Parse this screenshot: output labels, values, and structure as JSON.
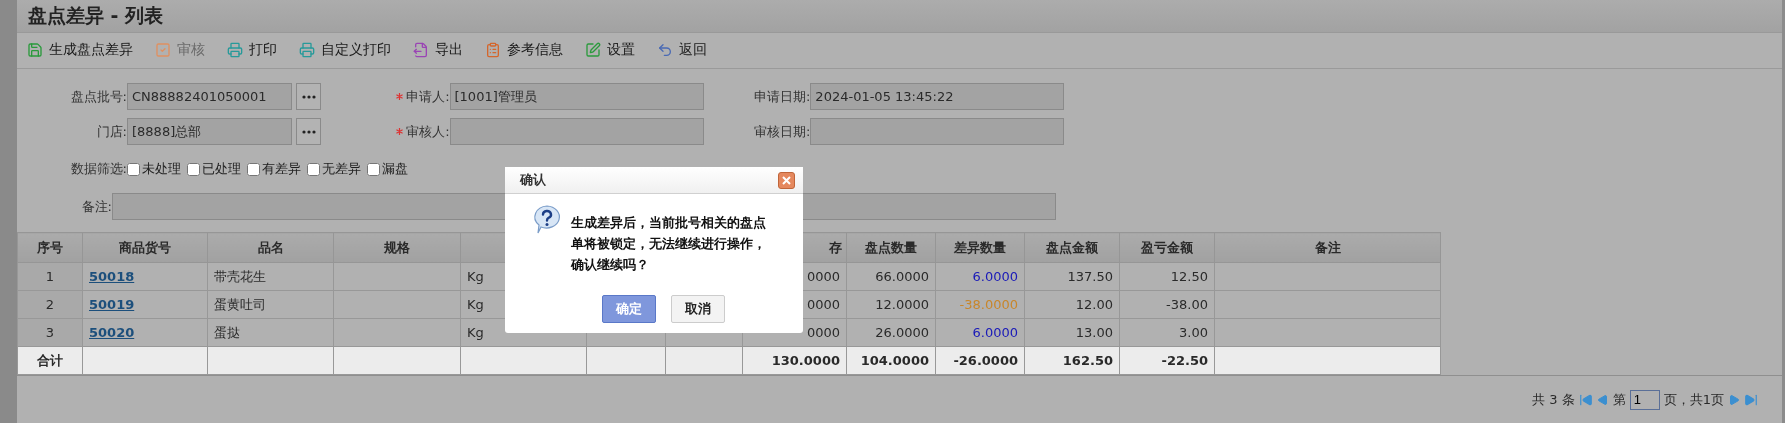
{
  "page": {
    "title": "盘点差异 - 列表"
  },
  "toolbar": [
    {
      "kind": "save",
      "label": "生成盘点差异",
      "disabled": false
    },
    {
      "kind": "check",
      "label": "审核",
      "disabled": true
    },
    {
      "kind": "print",
      "label": "打印",
      "disabled": false
    },
    {
      "kind": "print",
      "label": "自定义打印",
      "disabled": false
    },
    {
      "kind": "export",
      "label": "导出",
      "disabled": false
    },
    {
      "kind": "info",
      "label": "参考信息",
      "disabled": false
    },
    {
      "kind": "edit",
      "label": "设置",
      "disabled": false
    },
    {
      "kind": "back",
      "label": "返回",
      "disabled": false
    }
  ],
  "form": {
    "rows": [
      [
        {
          "label": "盘点批号:",
          "value": "CN88882401050001",
          "picker": true,
          "required": false
        },
        {
          "label": "申请人:",
          "value": "[1001]管理员",
          "picker": false,
          "required": true
        },
        {
          "label": "申请日期:",
          "value": "2024-01-05 13:45:22",
          "picker": false,
          "required": false
        }
      ],
      [
        {
          "label": "门店:",
          "value": "[8888]总部",
          "picker": true,
          "required": false
        },
        {
          "label": "审核人:",
          "picker": false,
          "required": true
        },
        {
          "label": "审核日期:",
          "picker": false,
          "required": false
        }
      ]
    ],
    "filter": {
      "label": "数据筛选:",
      "options": [
        {
          "label": "未处理",
          "checked": false
        },
        {
          "label": "已处理",
          "checked": false
        },
        {
          "label": "有差异",
          "checked": false
        },
        {
          "label": "无差异",
          "checked": false
        },
        {
          "label": "漏盘",
          "checked": false
        }
      ]
    },
    "note": {
      "label": "备注:"
    }
  },
  "table": {
    "columns": [
      {
        "label": "序号"
      },
      {
        "label": "商品货号"
      },
      {
        "label": "品名"
      },
      {
        "label": "规格"
      },
      {},
      {},
      {},
      {
        "label": "存"
      },
      {
        "label": "盘点数量"
      },
      {
        "label": "差异数量"
      },
      {
        "label": "盘点金额"
      },
      {
        "label": "盈亏金额"
      },
      {
        "label": "备注"
      }
    ],
    "rows": [
      {
        "no": "1",
        "code": "50018",
        "name": "带壳花生",
        "unit": "Kg",
        "column_8": "0000",
        "count": "66.0000",
        "diff": {
          "text": "6.0000",
          "color": "#1a1ab8"
        },
        "amount": "137.50",
        "profit": "12.50"
      },
      {
        "no": "2",
        "code": "50019",
        "name": "蛋黄吐司",
        "unit": "Kg",
        "column_8": "0000",
        "count": "12.0000",
        "diff": {
          "text": "-38.0000",
          "color": "#c8862a"
        },
        "amount": "12.00",
        "profit": "-38.00"
      },
      {
        "no": "3",
        "code": "50020",
        "name": "蛋挞",
        "unit": "Kg",
        "column_8": "0000",
        "count": "26.0000",
        "diff": {
          "text": "6.0000",
          "color": "#1a1ab8"
        },
        "amount": "13.00",
        "profit": "3.00"
      }
    ],
    "total": {
      "label": "合计",
      "column_8": "130.0000",
      "count": "104.0000",
      "diff": "-26.0000",
      "amount": "162.50",
      "profit": "-22.50"
    }
  },
  "pagination": {
    "total": "共 3 条",
    "page_prefix": "第",
    "page": "1",
    "page_suffix": "页，共1页"
  },
  "dialog": {
    "title": "确认",
    "message": "生成差异后，当前批号相关的盘点单将被锁定，无法继续进行操作，确认继续吗？",
    "buttons": [
      {
        "label": "确定",
        "selected": true
      },
      {
        "label": "取消",
        "selected": false
      }
    ]
  }
}
